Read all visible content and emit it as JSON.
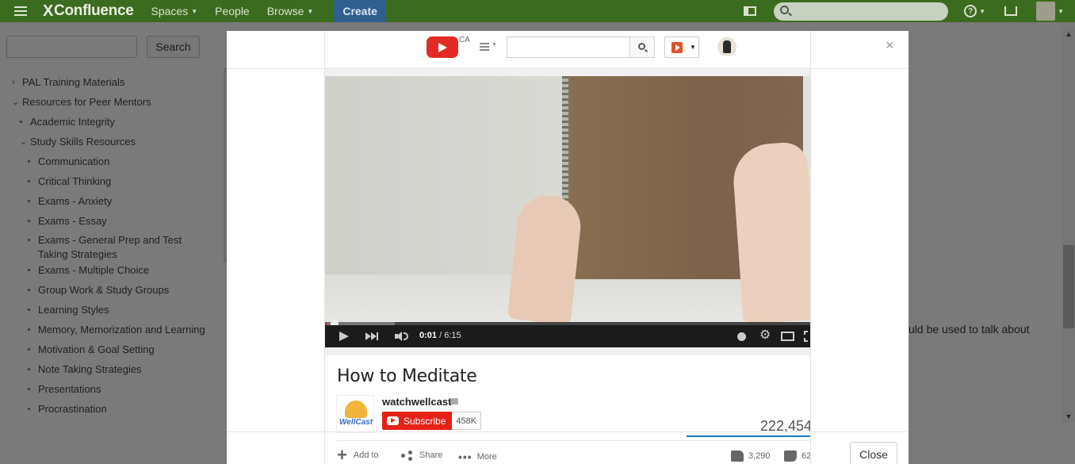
{
  "topbar": {
    "logo": "Confluence",
    "logo_mark": "X",
    "nav": [
      "Spaces",
      "People",
      "Browse"
    ],
    "create_label": "Create",
    "colors": {
      "bar": "#3b6b1f",
      "create": "#2f5f8f"
    }
  },
  "sidebar": {
    "search_button": "Search",
    "items": [
      {
        "label": "PAL Training Materials",
        "marker": "›"
      },
      {
        "label": "Resources for Peer Mentors",
        "marker": "⌄"
      },
      {
        "label": "Academic Integrity",
        "marker": "•"
      },
      {
        "label": "Study Skills Resources",
        "marker": "⌄"
      },
      {
        "label": "Communication",
        "marker": "•"
      },
      {
        "label": "Critical Thinking",
        "marker": "•"
      },
      {
        "label": "Exams - Anxiety",
        "marker": "•"
      },
      {
        "label": "Exams - Essay",
        "marker": "•"
      },
      {
        "label": "Exams - General Prep and Test",
        "label2": "Taking Strategies",
        "marker": "•"
      },
      {
        "label": "Exams - Multiple Choice",
        "marker": "•"
      },
      {
        "label": "Group Work & Study Groups",
        "marker": "•"
      },
      {
        "label": "Learning Styles",
        "marker": "•"
      },
      {
        "label": "Memory, Memorization and Learning",
        "marker": "•"
      },
      {
        "label": "Motivation & Goal Setting",
        "marker": "•"
      },
      {
        "label": "Note Taking Strategies",
        "marker": "•"
      },
      {
        "label": "Presentations",
        "marker": "•"
      },
      {
        "label": "Procrastination",
        "marker": "•"
      }
    ]
  },
  "page": {
    "partial_text": "uld be used to talk about"
  },
  "dialog": {
    "close_x": "×",
    "close_button": "Close"
  },
  "youtube": {
    "region": "CA",
    "search_placeholder": "",
    "player": {
      "current_time": "0:01",
      "duration": "/ 6:15",
      "played_fraction": 0.003,
      "buffered_fraction": 0.14
    },
    "video_title": "How to Meditate",
    "channel_name": "watchwellcast",
    "channel_logo_text": "WellCast",
    "subscribe_label": "Subscribe",
    "subscriber_count": "458K",
    "view_count": "222,454",
    "actions": {
      "add_to": "Add to",
      "share": "Share",
      "more": "More",
      "likes": "3,290",
      "dislikes": "62"
    },
    "colors": {
      "logo": "#e32b25",
      "subscribe": "#e62117",
      "progress_played": "#d32222",
      "views_bar": "#167ac6"
    }
  }
}
